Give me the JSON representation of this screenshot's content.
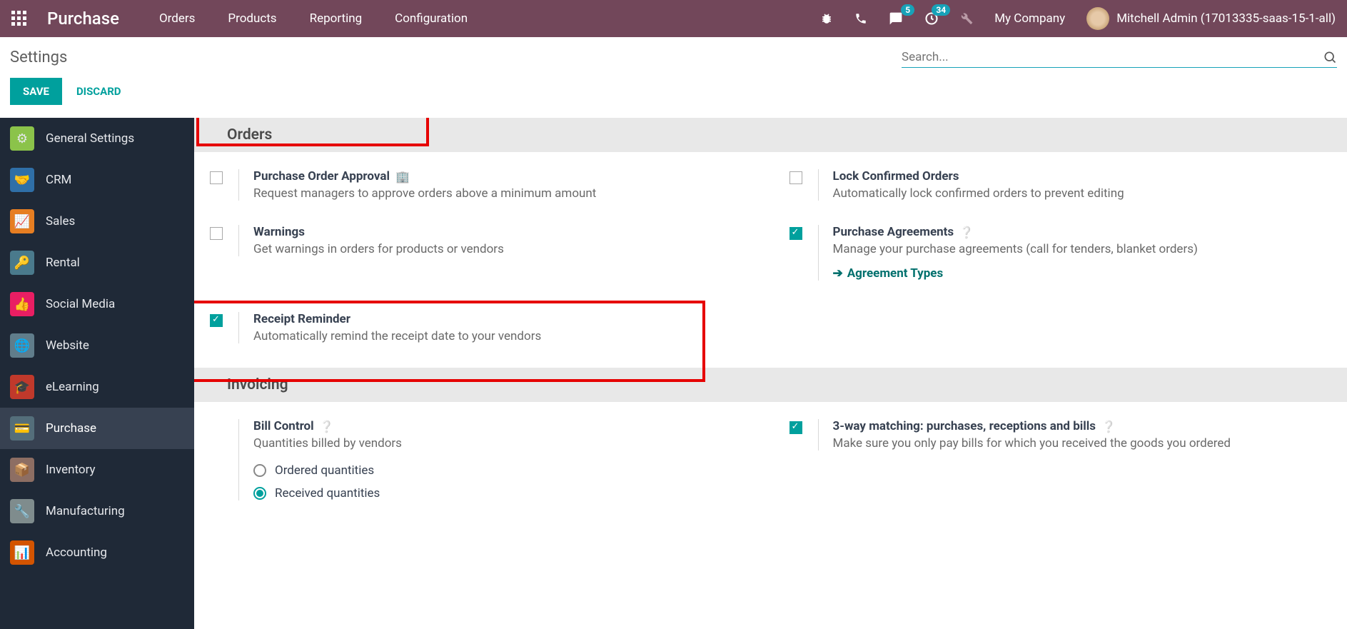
{
  "nav": {
    "brand": "Purchase",
    "menu": [
      "Orders",
      "Products",
      "Reporting",
      "Configuration"
    ],
    "msg_badge": "5",
    "activity_badge": "34",
    "company": "My Company",
    "user": "Mitchell Admin (17013335-saas-15-1-all)"
  },
  "control": {
    "title": "Settings",
    "search_placeholder": "Search...",
    "save": "SAVE",
    "discard": "DISCARD"
  },
  "sidebar": [
    {
      "label": "General Settings",
      "bg": "#8bc34a"
    },
    {
      "label": "CRM",
      "bg": "#2f6fa7"
    },
    {
      "label": "Sales",
      "bg": "#e67e22"
    },
    {
      "label": "Rental",
      "bg": "#4a7a8c"
    },
    {
      "label": "Social Media",
      "bg": "#e91e63"
    },
    {
      "label": "Website",
      "bg": "#607d8b"
    },
    {
      "label": "eLearning",
      "bg": "#c0392b"
    },
    {
      "label": "Purchase",
      "bg": "#546e7a",
      "active": true
    },
    {
      "label": "Inventory",
      "bg": "#8d6e63"
    },
    {
      "label": "Manufacturing",
      "bg": "#7f8c8d"
    },
    {
      "label": "Accounting",
      "bg": "#d35400"
    }
  ],
  "sections": {
    "orders": {
      "title": "Orders",
      "purchase_approval": {
        "t": "Purchase Order Approval",
        "d": "Request managers to approve orders above a minimum amount"
      },
      "warnings": {
        "t": "Warnings",
        "d": "Get warnings in orders for products or vendors"
      },
      "receipt_reminder": {
        "t": "Receipt Reminder",
        "d": "Automatically remind the receipt date to your vendors"
      },
      "lock_confirmed": {
        "t": "Lock Confirmed Orders",
        "d": "Automatically lock confirmed orders to prevent editing"
      },
      "agreements": {
        "t": "Purchase Agreements",
        "d": "Manage your purchase agreements (call for tenders, blanket orders)",
        "link": "Agreement Types"
      }
    },
    "invoicing": {
      "title": "Invoicing",
      "bill_control": {
        "t": "Bill Control",
        "d": "Quantities billed by vendors",
        "r1": "Ordered quantities",
        "r2": "Received quantities"
      },
      "three_way": {
        "t": "3-way matching: purchases, receptions and bills",
        "d": "Make sure you only pay bills for which you received the goods you ordered"
      }
    }
  }
}
